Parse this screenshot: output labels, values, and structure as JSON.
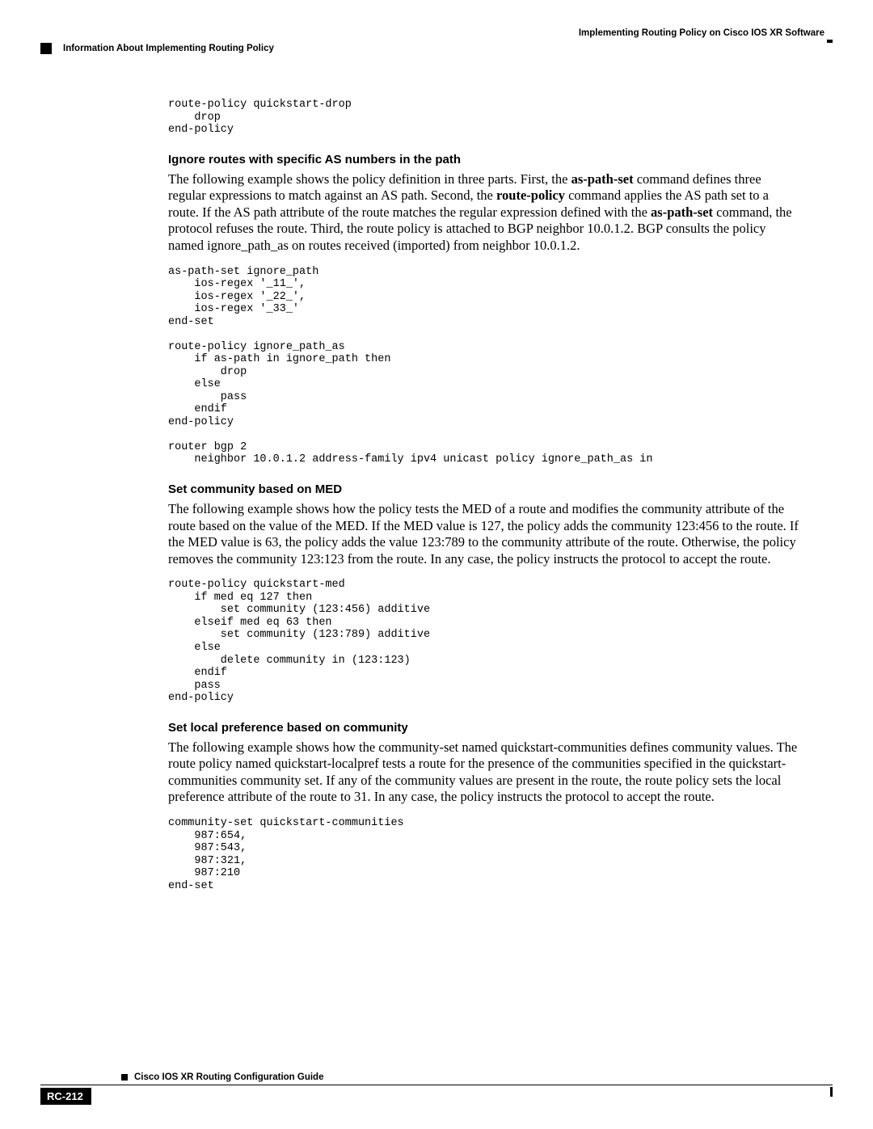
{
  "header": {
    "right": "Implementing Routing Policy on Cisco IOS XR Software",
    "left": "Information About Implementing Routing Policy"
  },
  "code1": "route-policy quickstart-drop\n    drop\nend-policy",
  "section1": {
    "heading": "Ignore routes with specific AS numbers in the path",
    "body_parts": {
      "p1": "The following example shows the policy definition in three parts. First, the ",
      "b1": "as-path-set",
      "p2": " command defines three regular expressions to match against an AS path. Second, the ",
      "b2": "route-policy",
      "p3": " command applies the AS path set to a route. If the AS path attribute of the route matches the regular expression defined with the ",
      "b3": "as-path-set",
      "p4": " command, the protocol refuses the route. Third, the route policy is attached to BGP neighbor 10.0.1.2. BGP consults the policy named ignore_path_as on routes received (imported) from neighbor 10.0.1.2."
    }
  },
  "code2": "as-path-set ignore_path\n    ios-regex '_11_',\n    ios-regex '_22_',\n    ios-regex '_33_'\nend-set\n\nroute-policy ignore_path_as\n    if as-path in ignore_path then\n        drop\n    else\n        pass\n    endif\nend-policy\n\nrouter bgp 2\n    neighbor 10.0.1.2 address-family ipv4 unicast policy ignore_path_as in",
  "section2": {
    "heading": "Set community based on MED",
    "body": "The following example shows how the policy tests the MED of a route and modifies the community attribute of the route based on the value of the MED. If the MED value is 127, the policy adds the community 123:456 to the route. If the MED value is 63, the policy adds the value 123:789 to the community attribute of the route. Otherwise, the policy removes the community 123:123 from the route. In any case, the policy instructs the protocol to accept the route."
  },
  "code3": "route-policy quickstart-med\n    if med eq 127 then\n        set community (123:456) additive\n    elseif med eq 63 then\n        set community (123:789) additive\n    else\n        delete community in (123:123)\n    endif\n    pass\nend-policy",
  "section3": {
    "heading": "Set local preference based on community",
    "body": "The following example shows how the community-set named quickstart-communities defines community values. The route policy named quickstart-localpref tests a route for the presence of the communities specified in the quickstart-communities community set. If any of the community values are present in the route, the route policy sets the local preference attribute of the route to 31. In any case, the policy instructs the protocol to accept the route."
  },
  "code4": "community-set quickstart-communities\n    987:654,\n    987:543,\n    987:321,\n    987:210\nend-set",
  "footer": {
    "title": "Cisco IOS XR Routing Configuration Guide",
    "page": "RC-212"
  }
}
